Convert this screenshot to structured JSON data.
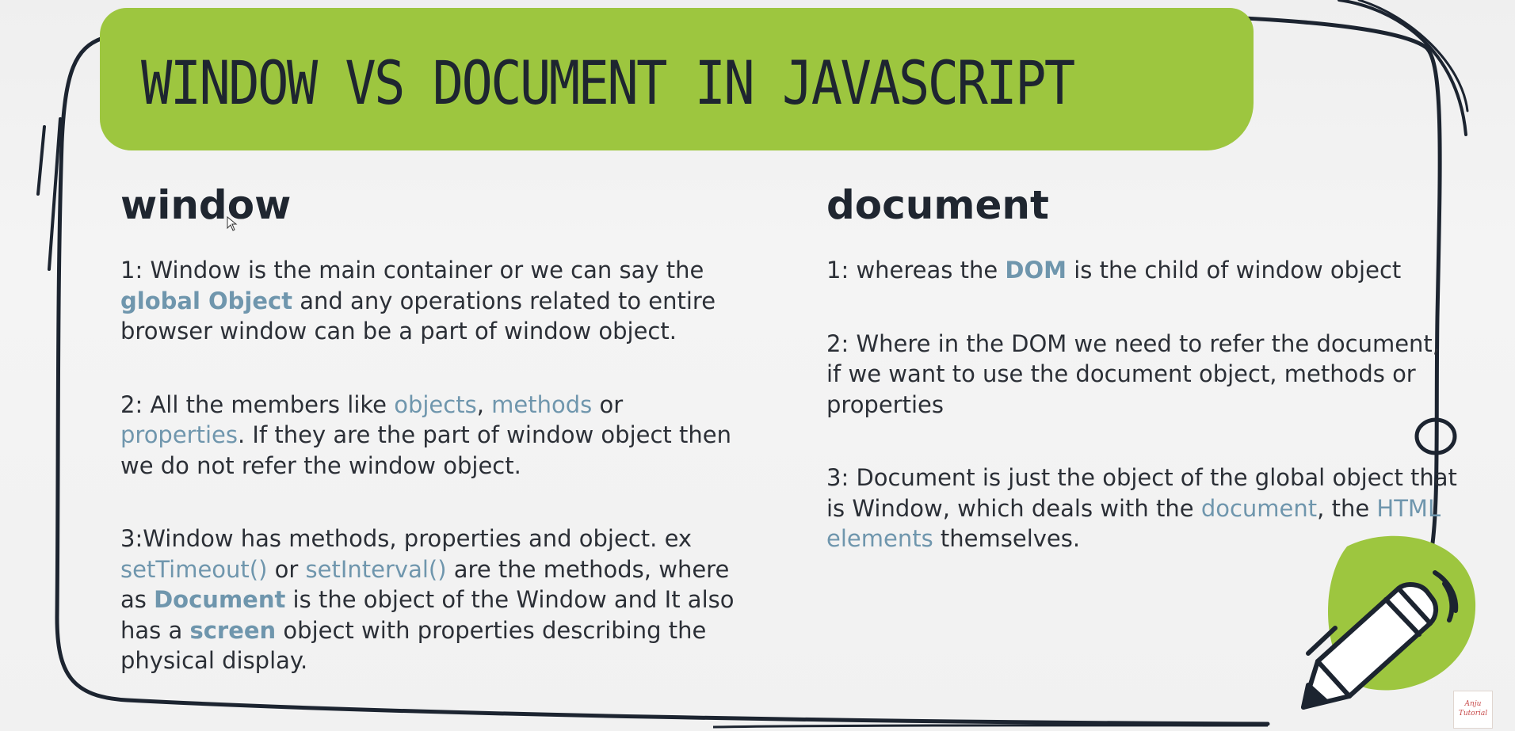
{
  "slide": {
    "title": "Window vs document in javascript",
    "accent_color": "#9dc63f",
    "highlight_color": "#6f96ad"
  },
  "left": {
    "heading": "window",
    "p1": {
      "a": "1: Window is the main container or we can say the ",
      "b": "global Object",
      "c": " and any operations related to entire browser window can be a part of window object."
    },
    "p2": {
      "a": "2: All the members like ",
      "b": "objects",
      "c": ", ",
      "d": "methods",
      "e": " or ",
      "f": "properties",
      "g": ". If they are the part of window object then we do not refer the window object."
    },
    "p3": {
      "a": "3:Window has methods, properties and object.  ex ",
      "b": "setTimeout()",
      "c": " or ",
      "d": "setInterval()",
      "e": " are the methods, where as ",
      "f": "Document",
      "g": " is the object of the Window and It also has a ",
      "h": "screen",
      "i": " object with properties describing the physical display."
    }
  },
  "right": {
    "heading": "document",
    "p1": {
      "a": "1: whereas the ",
      "b": "DOM",
      "c": " is the child of window object"
    },
    "p2": {
      "a": "2: Where in the DOM we need to refer the document, if we want to use the document object, methods or properties"
    },
    "p3": {
      "a": "3: Document is just the object of the global object that is Window, which deals with the ",
      "b": "document",
      "c": ", the ",
      "d": "HTML elements",
      "e": " themselves."
    }
  },
  "watermark": {
    "line1": "Anju",
    "line2": "Tutorial"
  },
  "icons": {
    "pencil": "pencil-icon",
    "cursor": "mouse-cursor-icon"
  }
}
